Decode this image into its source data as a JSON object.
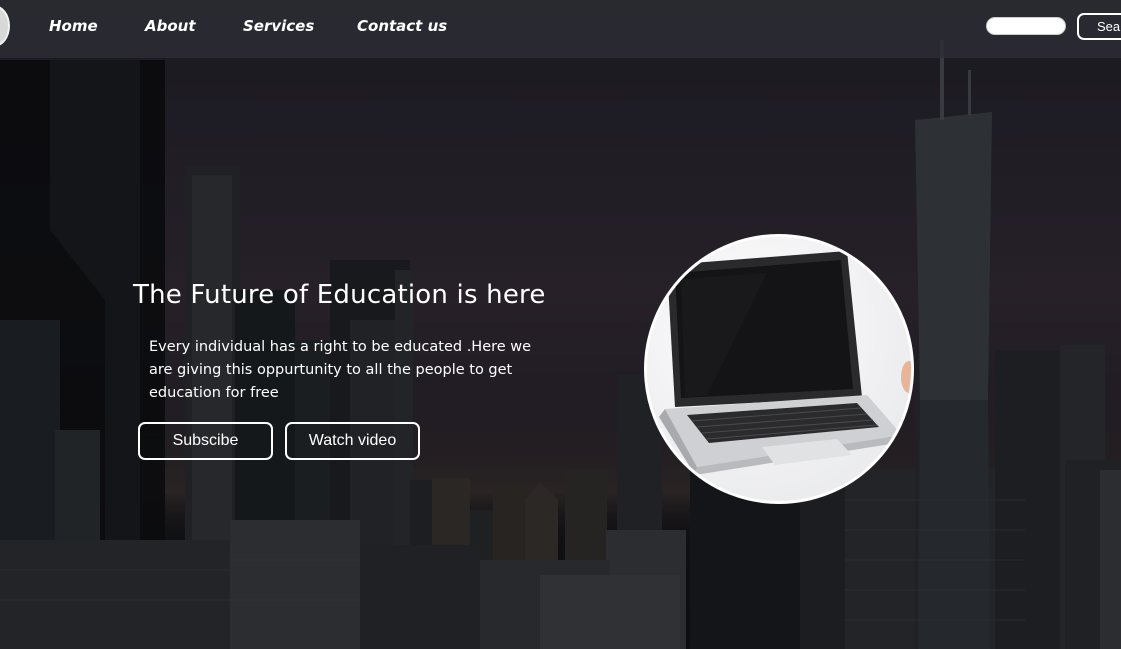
{
  "nav": {
    "links": [
      {
        "label": "Home"
      },
      {
        "label": "About"
      },
      {
        "label": "Services"
      },
      {
        "label": "Contact us"
      }
    ],
    "search": {
      "placeholder": "",
      "value": "",
      "button_label": "Search"
    }
  },
  "hero": {
    "title": "The Future of Education is here",
    "text": "Every individual has a right to be educated .Here we are giving this oppurtunity to all the people to get education for free",
    "buttons": {
      "subscribe_label": "Subscibe",
      "watch_label": "Watch video"
    }
  },
  "colors": {
    "navbar": "#2d2d34",
    "text": "#ffffff",
    "accent_border": "#ffffff"
  },
  "icons": {
    "logo": "logo-icon",
    "hero_image": "laptop-image"
  }
}
